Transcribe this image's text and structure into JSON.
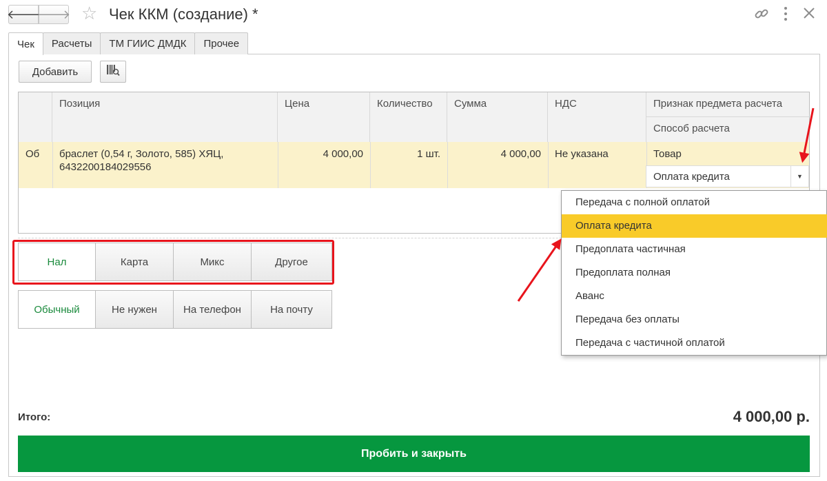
{
  "window": {
    "title": "Чек ККМ (создание) *"
  },
  "tabs": [
    {
      "label": "Чек",
      "active": true
    },
    {
      "label": "Расчеты",
      "active": false
    },
    {
      "label": "ТМ ГИИС ДМДК",
      "active": false
    },
    {
      "label": "Прочее",
      "active": false
    }
  ],
  "toolbar": {
    "add_label": "Добавить"
  },
  "table": {
    "headers": {
      "position": "Позиция",
      "price": "Цена",
      "quantity": "Количество",
      "sum": "Сумма",
      "vat": "НДС",
      "subject": "Признак предмета расчета",
      "method": "Способ расчета"
    },
    "row": {
      "marker": "Об",
      "position_line1": "браслет (0,54 г, Золото, 585) ХЯЦ,",
      "position_line2": "6432200184029556",
      "price": "4 000,00",
      "quantity": "1 шт.",
      "sum": "4 000,00",
      "vat": "Не указана",
      "subject": "Товар",
      "method": "Оплата кредита"
    }
  },
  "dropdown": {
    "options": [
      "Передача с полной оплатой",
      "Оплата кредита",
      "Предоплата частичная",
      "Предоплата полная",
      "Аванс",
      "Передача без оплаты",
      "Передача с частичной оплатой"
    ],
    "selected": "Оплата кредита"
  },
  "payment_type": {
    "options": [
      "Нал",
      "Карта",
      "Микс",
      "Другое"
    ],
    "selected": "Нал"
  },
  "receipt_type": {
    "options": [
      "Обычный",
      "Не нужен",
      "На телефон",
      "На почту"
    ],
    "selected": "Обычный"
  },
  "footer": {
    "total_label": "Итого:",
    "total_value": "4 000,00 р.",
    "submit_label": "Пробить и закрыть"
  },
  "colors": {
    "accent_green": "#06973f",
    "selection_yellow": "#f9cb29",
    "row_highlight": "#fbf2cb",
    "annotation_red": "#e8141c"
  }
}
